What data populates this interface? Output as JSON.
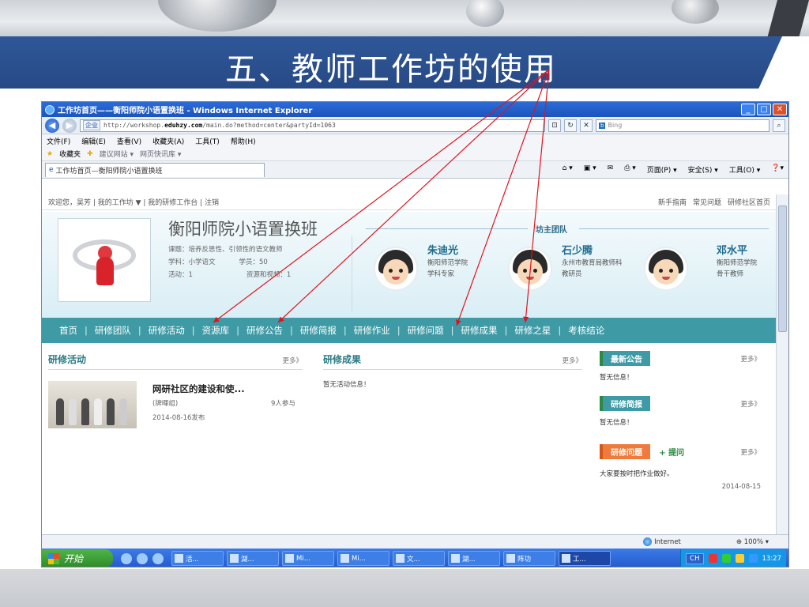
{
  "slide": {
    "title": "五、教师工作坊的使用"
  },
  "browser": {
    "window_title": "工作坊首页——衡阳师院小语置换班 - Windows Internet Explorer",
    "zone": "企业",
    "url_prefix": "http://workshop.",
    "url_domain": "eduhzy.com",
    "url_suffix": "/main.do?method=center&partyId=1063",
    "search_provider": "Bing",
    "menu": [
      "文件(F)",
      "编辑(E)",
      "查看(V)",
      "收藏夹(A)",
      "工具(T)",
      "帮助(H)"
    ],
    "favorites": {
      "label": "收藏夹",
      "suggested": "建议网站 ▾",
      "slices": "网页快讯库 ▾"
    },
    "tab_title": "工作坊首页—衡阳师院小语置换班",
    "tab_tools": [
      "页面(P) ▾",
      "安全(S) ▾",
      "工具(O) ▾"
    ]
  },
  "page": {
    "userbar_left": "欢迎您，吴芳 | 我的工作坊 ▼ | 我的研修工作台 | 注销",
    "userbar_right": [
      "新手指南",
      "常见问题",
      "研修社区首页"
    ],
    "studio_name": "衡阳师院小语置换班",
    "topic": "课题：培养反思性、引领性的语文教师",
    "subject": "学科：小学语文",
    "members": "学员：50",
    "activities": "活动：1",
    "resources": "资源和视频：1",
    "team_title": "坊主团队",
    "team": [
      {
        "name": "朱迪光",
        "info1": "衡阳师范学院",
        "info2": "学科专家"
      },
      {
        "name": "石少腾",
        "info1": "永州市教育局教师科",
        "info2": "教研员"
      },
      {
        "name": "邓水平",
        "info1": "衡阳师范学院",
        "info2": "骨干教师"
      }
    ],
    "nav": [
      "首页",
      "研修团队",
      "研修活动",
      "资源库",
      "研修公告",
      "研修简报",
      "研修作业",
      "研修问题",
      "研修成果",
      "研修之星",
      "考核结论"
    ],
    "more": "更多》",
    "activities_section": {
      "title": "研修活动",
      "item_title": "网研社区的建设和使...",
      "item_group": "(牌暉组)",
      "item_join": "9人参与",
      "item_date": "2014-08-16发布"
    },
    "results_section": {
      "title": "研修成果",
      "empty": "暂无活动信息！"
    },
    "sidebar": {
      "notice_title": "最新公告",
      "notice_empty": "暂无信息！",
      "brief_title": "研修简报",
      "brief_empty": "暂无信息！",
      "question_title": "研修问题",
      "ask_label": "+ 提问",
      "question_text": "大家要按时把作业做好。",
      "question_date": "2014-08-15"
    }
  },
  "status": {
    "zone": "Internet",
    "zoom": "100%"
  },
  "taskbar": {
    "start": "开始",
    "tasks": [
      "活...",
      "湖...",
      "Mi...",
      "Mi...",
      "文...",
      "湖...",
      "阵功",
      "工..."
    ],
    "lang": "CH",
    "time": "13:27"
  },
  "colors": {
    "slide_title_bg": "#2f5798",
    "nav_bg": "#3e9ba6",
    "annotation_arrow": "#e0141e"
  }
}
